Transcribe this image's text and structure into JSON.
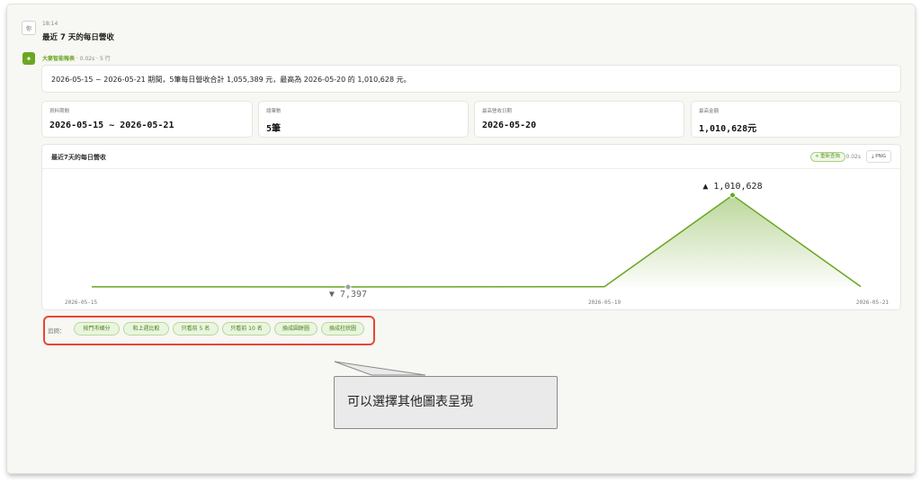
{
  "user": {
    "avatar": "你",
    "time": "18:14",
    "message": "最近 7 天的每日營收"
  },
  "bot": {
    "name": "大麥智能報表",
    "meta": " · 0.02s · 5 行",
    "icon": "sparkle-icon"
  },
  "summary": "2026-05-15 ~ 2026-05-21 期間，5筆每日營收合計 1,055,389 元，最高為 2026-05-20 的 1,010,628 元。",
  "stats": [
    {
      "label": "資料期間",
      "value": "2026-05-15 ~ 2026-05-21"
    },
    {
      "label": "總筆數",
      "value": "5筆"
    },
    {
      "label": "最高營收日期",
      "value": "2026-05-20"
    },
    {
      "label": "最高金額",
      "value": "1,010,628元"
    }
  ],
  "chart_header": {
    "title": "最近7天的每日營收",
    "refresh_label": "⟡ 重新查詢",
    "time": "0.02s",
    "png_label": "⤓ PNG"
  },
  "chart_data": {
    "type": "area",
    "title": "",
    "xlabel": "",
    "ylabel": "",
    "x": [
      "2026-05-15",
      "2026-05-17",
      "2026-05-19",
      "2026-05-20",
      "2026-05-21"
    ],
    "values": [
      9000,
      7397,
      10000,
      1010628,
      10700
    ],
    "x_tick_labels": [
      "2026-05-15",
      "2026-05-19",
      "2026-05-21"
    ],
    "annotations": [
      {
        "x": "2026-05-20",
        "value": 1010628,
        "label": "▲ 1,010,628"
      },
      {
        "x": "2026-05-17",
        "value": 7397,
        "label": "▼ 7,397"
      }
    ],
    "ylim": [
      0,
      1100000
    ],
    "grid": false,
    "line_color": "#6aa622",
    "fill_color": "#6aa622"
  },
  "suggestions": {
    "label": "追問：",
    "chips": [
      "按門市細分",
      "和上週比較",
      "只看前 5 名",
      "只看前 10 名",
      "換成圓餅圖",
      "換成柱狀圖"
    ]
  },
  "callout": {
    "text": "可以選擇其他圖表呈現"
  }
}
